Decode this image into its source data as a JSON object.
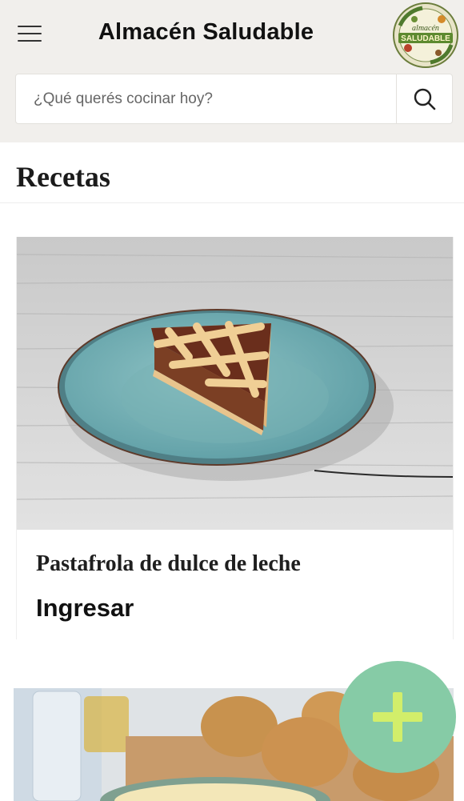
{
  "header": {
    "brand": "Almacén Saludable",
    "menu_icon": "hamburger-icon",
    "logo_text": "almacén SALUDABLE",
    "logo_ring_text": "SALUDABLE"
  },
  "search": {
    "placeholder": "¿Qué querés cocinar hoy?",
    "icon": "search-icon"
  },
  "section": {
    "title": "Recetas"
  },
  "recipes": [
    {
      "title": "Pastafrola de dulce de leche",
      "action": "Ingresar"
    },
    {
      "title": "",
      "action": ""
    }
  ],
  "fab": {
    "icon": "plus-icon",
    "color": "#86cba6",
    "plus_color": "#d2ee6a"
  }
}
